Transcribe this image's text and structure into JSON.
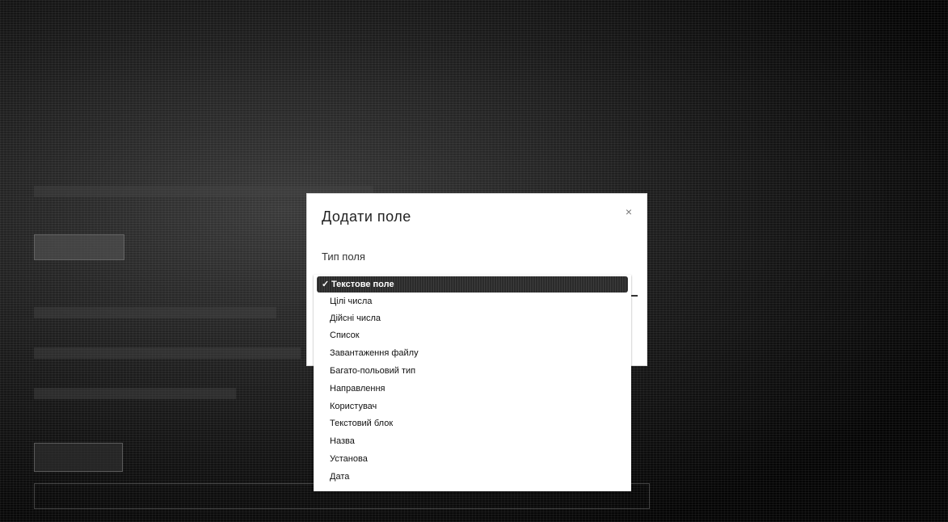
{
  "modal": {
    "title": "Додати поле",
    "close_glyph": "×",
    "field_label": "Тип поля"
  },
  "dropdown": {
    "selected_check": "✓",
    "options": [
      "Текстове поле",
      "Цілі числа",
      "Дійсні числа",
      "Список",
      "Завантаження файлу",
      "Багато-польовий тип",
      "Направлення",
      "Користувач",
      "Текстовий блок",
      "Назва",
      "Установа",
      "Дата"
    ]
  },
  "colors": {
    "selected_bg": "#2b2b2b",
    "modal_bg": "#ffffff"
  }
}
